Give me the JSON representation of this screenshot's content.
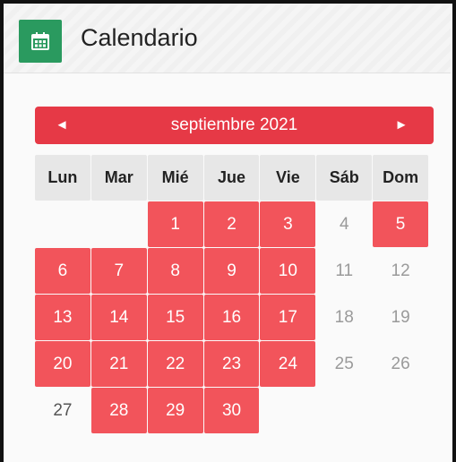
{
  "header": {
    "title": "Calendario",
    "icon": "calendar-icon",
    "icon_bg": "#2a9a5f"
  },
  "calendar": {
    "month_label": "septiembre 2021",
    "prev_symbol": "◄",
    "next_symbol": "►",
    "accent": "#e63946",
    "day_color": "#f2545b",
    "weekdays": [
      "Lun",
      "Mar",
      "Mié",
      "Jue",
      "Vie",
      "Sáb",
      "Dom"
    ],
    "weeks": [
      [
        {
          "d": "",
          "s": "empty"
        },
        {
          "d": "",
          "s": "empty"
        },
        {
          "d": "1",
          "s": "on"
        },
        {
          "d": "2",
          "s": "on"
        },
        {
          "d": "3",
          "s": "on"
        },
        {
          "d": "4",
          "s": "off"
        },
        {
          "d": "5",
          "s": "on"
        }
      ],
      [
        {
          "d": "6",
          "s": "on"
        },
        {
          "d": "7",
          "s": "on"
        },
        {
          "d": "8",
          "s": "on"
        },
        {
          "d": "9",
          "s": "on"
        },
        {
          "d": "10",
          "s": "on"
        },
        {
          "d": "11",
          "s": "off"
        },
        {
          "d": "12",
          "s": "off"
        }
      ],
      [
        {
          "d": "13",
          "s": "on"
        },
        {
          "d": "14",
          "s": "on"
        },
        {
          "d": "15",
          "s": "on"
        },
        {
          "d": "16",
          "s": "on"
        },
        {
          "d": "17",
          "s": "on"
        },
        {
          "d": "18",
          "s": "off"
        },
        {
          "d": "19",
          "s": "off"
        }
      ],
      [
        {
          "d": "20",
          "s": "on"
        },
        {
          "d": "21",
          "s": "on"
        },
        {
          "d": "22",
          "s": "on"
        },
        {
          "d": "23",
          "s": "on"
        },
        {
          "d": "24",
          "s": "on"
        },
        {
          "d": "25",
          "s": "off"
        },
        {
          "d": "26",
          "s": "off"
        }
      ],
      [
        {
          "d": "27",
          "s": "plain"
        },
        {
          "d": "28",
          "s": "on"
        },
        {
          "d": "29",
          "s": "on"
        },
        {
          "d": "30",
          "s": "on"
        },
        {
          "d": "",
          "s": "empty"
        },
        {
          "d": "",
          "s": "empty"
        },
        {
          "d": "",
          "s": "empty"
        }
      ]
    ]
  }
}
